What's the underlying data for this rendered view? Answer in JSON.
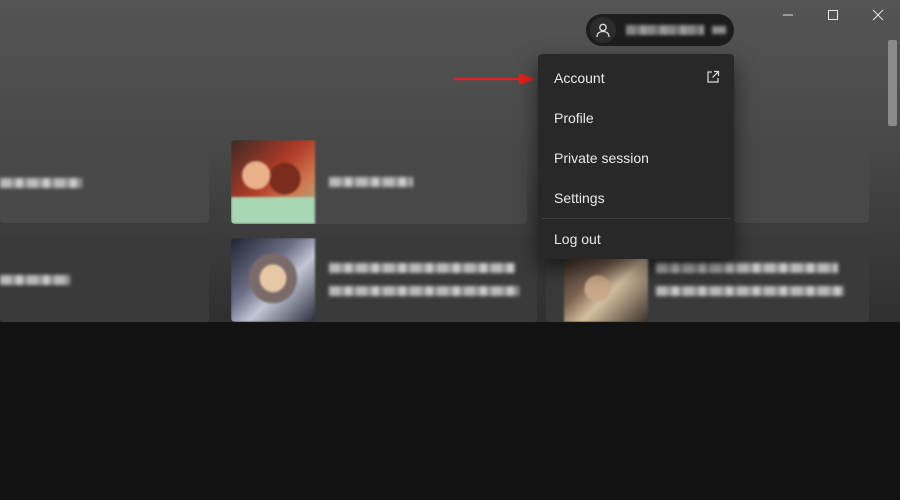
{
  "window": {
    "controls": [
      {
        "name": "minimize-button",
        "icon": "minimize-icon"
      },
      {
        "name": "maximize-button",
        "icon": "maximize-icon"
      },
      {
        "name": "close-button",
        "icon": "close-icon"
      }
    ]
  },
  "user_menu": {
    "trigger_icon": "user-icon",
    "items": [
      {
        "label": "Account",
        "icon": "external-link-icon"
      },
      {
        "label": "Profile"
      },
      {
        "label": "Private session"
      },
      {
        "label": "Settings"
      },
      {
        "label": "Log out"
      }
    ]
  },
  "annotation": {
    "arrow_color": "#e0201c"
  },
  "colors": {
    "background": "#121212",
    "gradient_top": "#545454",
    "card": "#484848",
    "menu": "#282828",
    "menu_text": "#eaeaea"
  }
}
